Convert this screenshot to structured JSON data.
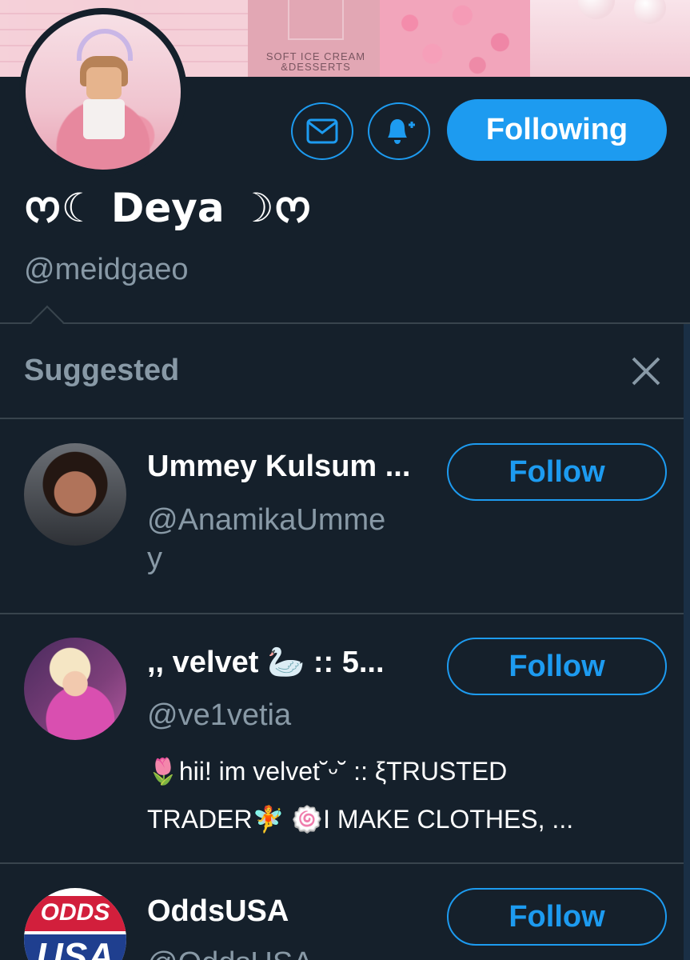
{
  "banner": {
    "text_line1": "SOFT ICE CREAM",
    "text_line2": "&DESSERTS"
  },
  "profile": {
    "display_name": "ᰔ☾ Deya ☽ᰔ",
    "handle": "@meidgaeo",
    "following_label": "Following",
    "icons": [
      "mail-icon",
      "bell-plus-icon"
    ]
  },
  "suggested": {
    "title": "Suggested",
    "close_icon": "close-icon",
    "items": [
      {
        "name": "Ummey Kulsum ...",
        "handle_line1": "@AnamikaUmme",
        "handle_line2": "y",
        "follow_label": "Follow"
      },
      {
        "name": ",, velvet 🦢 :: 5...",
        "handle_line1": "@ve1vetia",
        "bio_line1": "🌷hii! im velvet˘ᵕ˘ :: ξTRUSTED",
        "bio_line2": "TRADER🧚 🍥I MAKE CLOTHES, ...",
        "follow_label": "Follow"
      },
      {
        "name": "OddsUSA",
        "handle_line1": "@OddsUSA",
        "avatar_text_top": "ODDS",
        "avatar_text_bottom": "USA",
        "follow_label": "Follow"
      }
    ]
  },
  "colors": {
    "background": "#15202b",
    "accent": "#1d9bf0",
    "muted_text": "#8899a6",
    "divider": "#38444d"
  }
}
